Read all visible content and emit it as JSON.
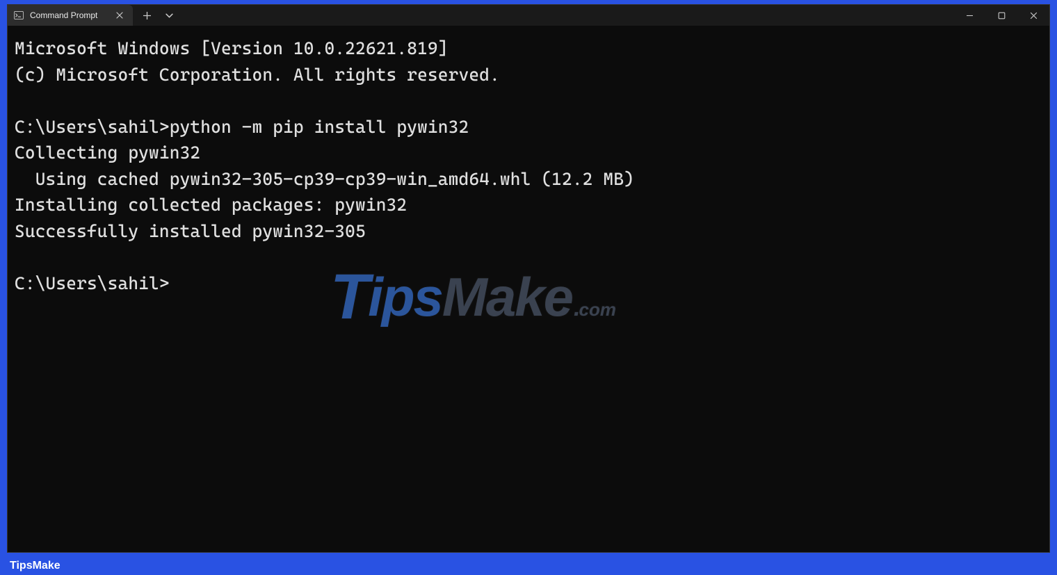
{
  "window": {
    "tab_title": "Command Prompt"
  },
  "terminal": {
    "lines": [
      "Microsoft Windows [Version 10.0.22621.819]",
      "(c) Microsoft Corporation. All rights reserved.",
      "",
      "C:\\Users\\sahil>python -m pip install pywin32",
      "Collecting pywin32",
      "  Using cached pywin32-305-cp39-cp39-win_amd64.whl (12.2 MB)",
      "Installing collected packages: pywin32",
      "Successfully installed pywin32-305",
      "",
      "C:\\Users\\sahil>"
    ]
  },
  "watermark": {
    "t": "T",
    "ips": "ips",
    "make": "Make",
    "dot": ".",
    "com": "com"
  },
  "footer": {
    "label": "TipsMake"
  }
}
